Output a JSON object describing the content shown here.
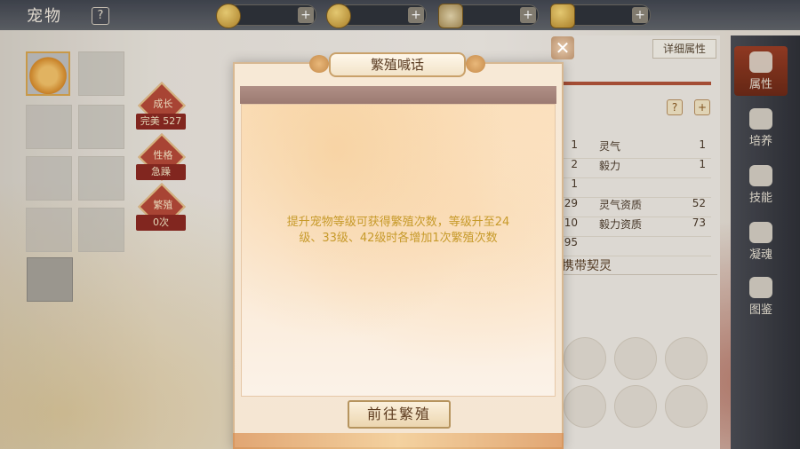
{
  "header": {
    "title": "宠物",
    "help": "?",
    "currencies": [
      {
        "icon": "copper-coin-icon",
        "plus": "+"
      },
      {
        "icon": "gold-coin-icon",
        "plus": "+"
      },
      {
        "icon": "silver-ingot-icon",
        "plus": "+"
      },
      {
        "icon": "gold-ingot-icon",
        "plus": "+"
      }
    ]
  },
  "left": {
    "growth_badge": "成长",
    "growth_label": "完美",
    "growth_value": "527",
    "temper_badge": "性格",
    "temper_value": "急躁",
    "breed_badge": "繁殖",
    "breed_value": "0次"
  },
  "right_panel": {
    "detail_button": "详细属性",
    "attributes": [
      {
        "lv": "1",
        "name": "灵气",
        "value": "1"
      },
      {
        "lv": "2",
        "name": "毅力",
        "value": "1"
      },
      {
        "lv": "1",
        "name": "",
        "value": ""
      },
      {
        "lv": "29",
        "name": "灵气资质",
        "value": "52"
      },
      {
        "lv": "10",
        "name": "毅力资质",
        "value": "73"
      },
      {
        "lv": "95",
        "name": "",
        "value": ""
      }
    ],
    "carry_title": "携带契灵"
  },
  "side_nav": {
    "items": [
      {
        "label": "属性",
        "icon": "paw-icon"
      },
      {
        "label": "培养",
        "icon": "cultivate-icon"
      },
      {
        "label": "技能",
        "icon": "scroll-icon"
      },
      {
        "label": "凝魂",
        "icon": "soul-icon"
      },
      {
        "label": "图鉴",
        "icon": "book-icon"
      }
    ]
  },
  "modal": {
    "title": "繁殖喊话",
    "text": "提升宠物等级可获得繁殖次数，等级升至24级、33级、42级时各增加1次繁殖次数",
    "button": "前往繁殖",
    "close": "✕"
  }
}
